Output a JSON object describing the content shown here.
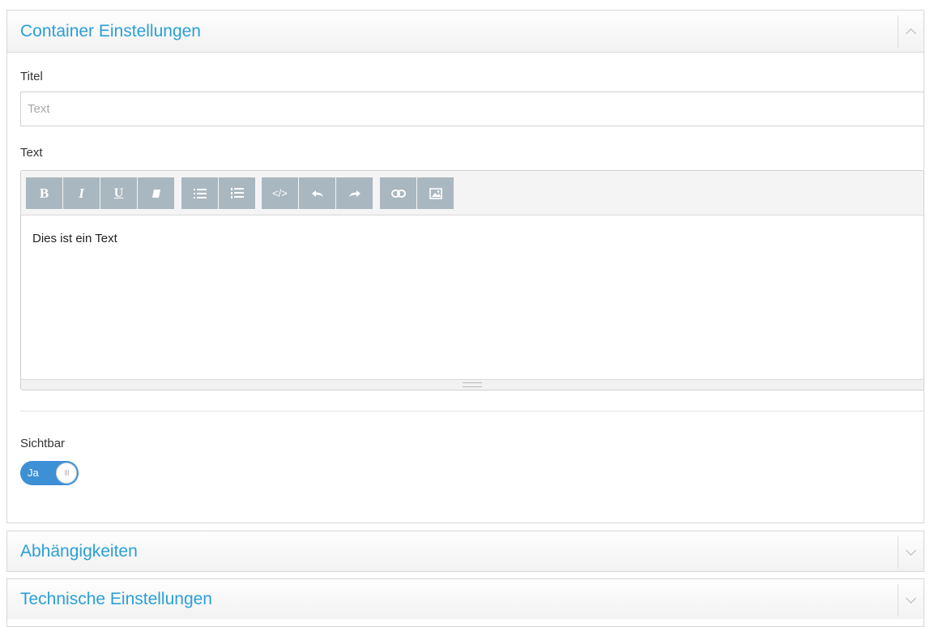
{
  "panels": [
    {
      "title": "Container Einstellungen",
      "expanded": true,
      "toggle_icon": "chevron-up-icon"
    },
    {
      "title": "Abhängigkeiten",
      "expanded": false,
      "toggle_icon": "chevron-down-icon"
    },
    {
      "title": "Technische Einstellungen",
      "expanded": false,
      "toggle_icon": "chevron-down-icon"
    }
  ],
  "form": {
    "titel_label": "Titel",
    "titel_placeholder": "Text",
    "titel_value": "",
    "text_label": "Text",
    "editor_content": "Dies ist ein Text",
    "sichtbar_label": "Sichtbar",
    "toggle_on_label": "Ja",
    "toggle_knob_glyph": "III",
    "sichtbar_value": true
  },
  "toolbar": {
    "bold_label": "B",
    "italic_label": "I",
    "underline_label": "U",
    "code_label": "</>",
    "icons": [
      "bold-icon",
      "italic-icon",
      "underline-icon",
      "eraser-icon",
      "unordered-list-icon",
      "ordered-list-icon",
      "code-view-icon",
      "undo-icon",
      "redo-icon",
      "link-icon",
      "image-icon"
    ]
  },
  "colors": {
    "accent": "#2a9fd6",
    "toolbar_button": "#a9b7c0",
    "toggle_on": "#3d8fd6"
  }
}
